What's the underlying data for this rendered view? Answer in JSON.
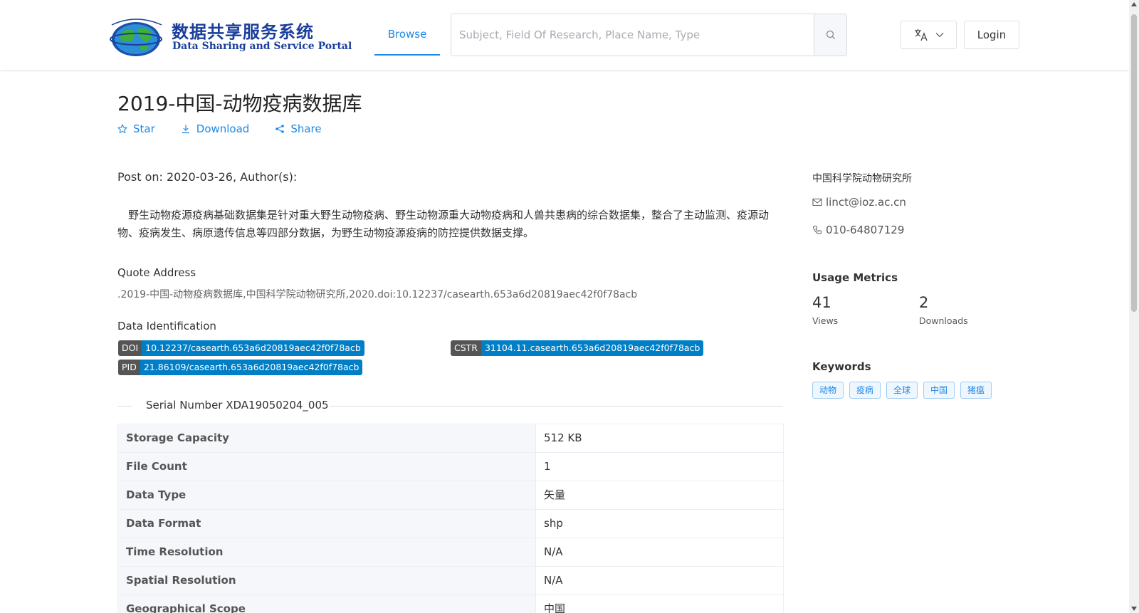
{
  "header": {
    "logo_cn": "数据共享服务系统",
    "logo_en": "Data Sharing and Service Portal",
    "nav_browse": "Browse",
    "search_placeholder": "Subject, Field Of Research, Place Name, Type",
    "login_label": "Login"
  },
  "dataset": {
    "title": "2019-中国-动物疫病数据库",
    "actions": {
      "star": "Star",
      "download": "Download",
      "share": "Share"
    },
    "post_on": "Post on: 2020-03-26, Author(s):",
    "description": "野生动物疫源疫病基础数据集是针对重大野生动物疫病、野生动物源重大动物疫病和人兽共患病的综合数据集，整合了主动监测、疫源动物、疫病发生、病原遗传信息等四部分数据，为野生动物疫源疫病的防控提供数据支撑。",
    "quote_label": "Quote Address",
    "quote_text": ".2019-中国-动物疫病数据库,中国科学院动物研究所,2020.doi:10.12237/casearth.653a6d20819aec42f0f78acb",
    "identification_label": "Data Identification",
    "ids": {
      "doi": {
        "key": "DOI",
        "value": "10.12237/casearth.653a6d20819aec42f0f78acb"
      },
      "cstr": {
        "key": "CSTR",
        "value": "31104.11.casearth.653a6d20819aec42f0f78acb"
      },
      "pid": {
        "key": "PID",
        "value": "21.86109/casearth.653a6d20819aec42f0f78acb"
      }
    },
    "serial_number": "Serial Number XDA19050204_005",
    "info": [
      {
        "key": "Storage Capacity",
        "value": "512 KB"
      },
      {
        "key": "File Count",
        "value": "1"
      },
      {
        "key": "Data Type",
        "value": "矢量"
      },
      {
        "key": "Data Format",
        "value": "shp"
      },
      {
        "key": "Time Resolution",
        "value": "N/A"
      },
      {
        "key": "Spatial Resolution",
        "value": "N/A"
      },
      {
        "key": "Geographical Scope",
        "value": "中国"
      }
    ]
  },
  "sidebar": {
    "organization": "中国科学院动物研究所",
    "email": "linct@ioz.ac.cn",
    "phone": "010-64807129",
    "usage_heading": "Usage Metrics",
    "views_count": "41",
    "views_label": "Views",
    "downloads_count": "2",
    "downloads_label": "Downloads",
    "keywords_heading": "Keywords",
    "keywords": [
      "动物",
      "疫病",
      "全球",
      "中国",
      "猪瘟"
    ]
  },
  "colors": {
    "accent": "#1f87e5",
    "badge_key": "#555555",
    "badge_value": "#007ec6",
    "logo": "#1a3f9c"
  },
  "icons": [
    "globe-logo-icon",
    "search-icon",
    "translate-icon",
    "chevron-down-icon",
    "star-icon",
    "download-icon",
    "share-icon",
    "mail-icon",
    "phone-icon"
  ]
}
